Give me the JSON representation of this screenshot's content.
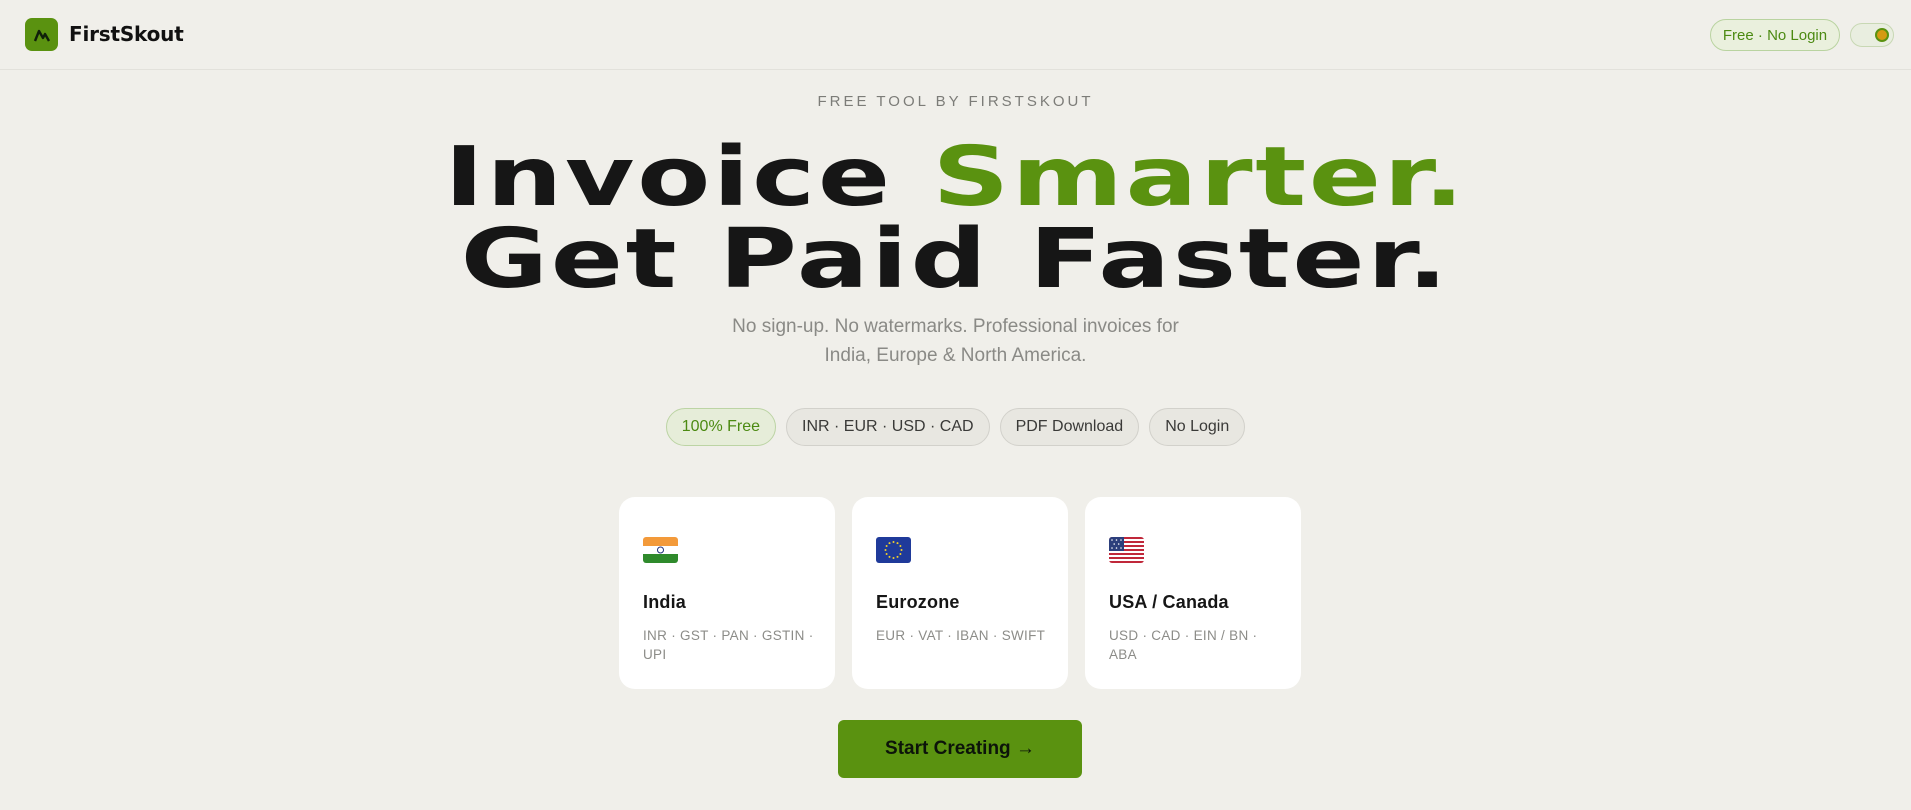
{
  "header": {
    "brand": "FirstSkout",
    "logo_icon": "mountain-peak-icon",
    "badge": "Free · No Login",
    "theme_toggle_icon": "theme-toggle-icon"
  },
  "hero": {
    "eyebrow": "FREE TOOL BY FIRSTSKOUT",
    "headline_line1_plain": "Invoice ",
    "headline_line1_accent": "Smarter.",
    "headline_line2": "Get Paid Faster.",
    "subtitle_line1": "No sign-up. No watermarks. Professional invoices for",
    "subtitle_line2": "India, Europe & North America."
  },
  "chips": [
    {
      "label": "100% Free",
      "highlight": true
    },
    {
      "label": "INR · EUR · USD · CAD",
      "highlight": false
    },
    {
      "label": "PDF Download",
      "highlight": false
    },
    {
      "label": "No Login",
      "highlight": false
    }
  ],
  "regions": [
    {
      "title": "India",
      "details": "INR · GST · PAN · GSTIN · UPI",
      "flag_icon": "india-flag-icon"
    },
    {
      "title": "Eurozone",
      "details": "EUR · VAT · IBAN · SWIFT",
      "flag_icon": "eu-flag-icon"
    },
    {
      "title": "USA / Canada",
      "details": "USD · CAD · EIN / BN · ABA",
      "flag_icon": "usa-flag-icon"
    }
  ],
  "cta": {
    "label": "Start Creating →"
  },
  "colors": {
    "accent": "#5a9210",
    "background": "#f0efea",
    "card": "#ffffff",
    "muted_text": "#8a8a86"
  }
}
